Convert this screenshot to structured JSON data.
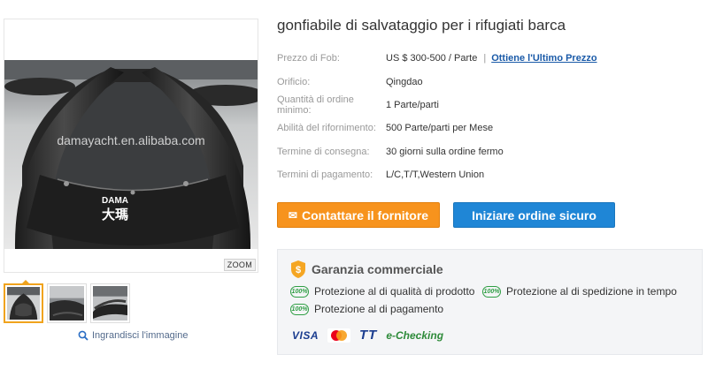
{
  "gallery": {
    "watermark_text": "damayacht.en.alibaba.com",
    "logo_text": "DAMA",
    "logo_cjk": "大瑪",
    "zoom_label": "ZOOM",
    "enlarge_label": "Ingrandisci l'immagine"
  },
  "product": {
    "title": "gonfiabile di salvataggio per i rifugiati barca",
    "attributes": [
      {
        "label": "Prezzo di Fob:",
        "value": "US $ 300-500 / Parte",
        "separator": "|",
        "link": "Ottiene l'Ultimo Prezzo"
      },
      {
        "label": "Orificio:",
        "value": "Qingdao"
      },
      {
        "label": "Quantità di ordine minimo:",
        "value": "1 Parte/parti"
      },
      {
        "label": "Abilità del rifornimento:",
        "value": "500 Parte/parti per Mese"
      },
      {
        "label": "Termine di consegna:",
        "value": "30 giorni sulla ordine fermo"
      },
      {
        "label": "Termini di pagamento:",
        "value": "L/C,T/T,Western Union"
      }
    ]
  },
  "actions": {
    "contact_label": "Contattare il fornitore",
    "order_label": "Iniziare ordine sicuro"
  },
  "guarantee": {
    "title": "Garanzia commerciale",
    "badge": "100%",
    "items": [
      "Protezione al di qualità di prodotto",
      "Protezione al di spedizione in tempo",
      "Protezione al di pagamento"
    ],
    "payments": {
      "visa": "VISA",
      "tt": "TT",
      "echecking": "e-Checking"
    }
  },
  "colors": {
    "contact_button": "#f7931d",
    "order_button": "#1f86d6",
    "link": "#1a5aa8",
    "guarantee_green": "#2f9e44"
  }
}
